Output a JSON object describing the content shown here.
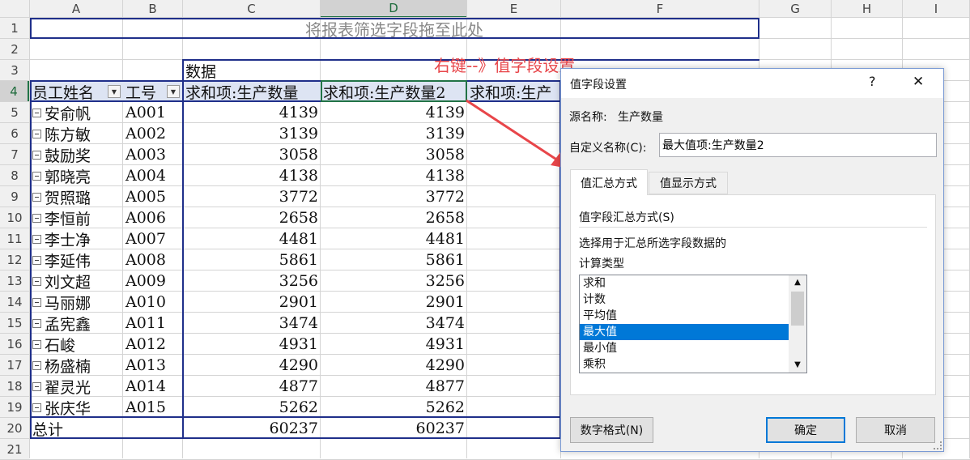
{
  "columns": [
    "A",
    "B",
    "C",
    "D",
    "E",
    "F",
    "G",
    "H",
    "I"
  ],
  "rows": [
    "1",
    "2",
    "3",
    "4",
    "5",
    "6",
    "7",
    "8",
    "9",
    "10",
    "11",
    "12",
    "13",
    "14",
    "15",
    "16",
    "17",
    "18",
    "19",
    "20",
    "21"
  ],
  "filter_drop_text": "将报表筛选字段拖至此处",
  "data_header": "数据",
  "field_headers": {
    "emp_name": "员工姓名",
    "emp_id": "工号",
    "sum1": "求和项:生产数量",
    "sum2": "求和项:生产数量2",
    "sum3": "求和项:生产"
  },
  "records": [
    {
      "name": "安俞帆",
      "id": "A001",
      "v1": "4139",
      "v2": "4139"
    },
    {
      "name": "陈方敏",
      "id": "A002",
      "v1": "3139",
      "v2": "3139"
    },
    {
      "name": "鼓励奖",
      "id": "A003",
      "v1": "3058",
      "v2": "3058"
    },
    {
      "name": "郭晓亮",
      "id": "A004",
      "v1": "4138",
      "v2": "4138"
    },
    {
      "name": "贺照璐",
      "id": "A005",
      "v1": "3772",
      "v2": "3772"
    },
    {
      "name": "李恒前",
      "id": "A006",
      "v1": "2658",
      "v2": "2658"
    },
    {
      "name": "李士净",
      "id": "A007",
      "v1": "4481",
      "v2": "4481"
    },
    {
      "name": "李延伟",
      "id": "A008",
      "v1": "5861",
      "v2": "5861"
    },
    {
      "name": "刘文超",
      "id": "A009",
      "v1": "3256",
      "v2": "3256"
    },
    {
      "name": "马丽娜",
      "id": "A010",
      "v1": "2901",
      "v2": "2901"
    },
    {
      "name": "孟宪鑫",
      "id": "A011",
      "v1": "3474",
      "v2": "3474"
    },
    {
      "name": "石峻",
      "id": "A012",
      "v1": "4931",
      "v2": "4931"
    },
    {
      "name": "杨盛楠",
      "id": "A013",
      "v1": "4290",
      "v2": "4290"
    },
    {
      "name": "翟灵光",
      "id": "A014",
      "v1": "4877",
      "v2": "4877"
    },
    {
      "name": "张庆华",
      "id": "A015",
      "v1": "5262",
      "v2": "5262"
    }
  ],
  "total": {
    "label": "总计",
    "v1": "60237",
    "v2": "60237"
  },
  "annotation": "右键--》值字段设置",
  "annotation_color": "#e8464a",
  "dialog": {
    "title": "值字段设置",
    "help": "?",
    "close": "✕",
    "source_label": "源名称:",
    "source_value": "生产数量",
    "custom_label": "自定义名称(C):",
    "custom_value": "最大值项:生产数量2",
    "tab_summarize": "值汇总方式",
    "tab_display": "值显示方式",
    "section_title": "值字段汇总方式(S)",
    "desc_line1": "选择用于汇总所选字段数据的",
    "desc_line2": "计算类型",
    "list_items": [
      "求和",
      "计数",
      "平均值",
      "最大值",
      "最小值",
      "乘积"
    ],
    "selected_index": 3,
    "number_format_btn": "数字格式(N)",
    "ok_btn": "确定",
    "cancel_btn": "取消",
    "accent_color": "#0078d7"
  }
}
